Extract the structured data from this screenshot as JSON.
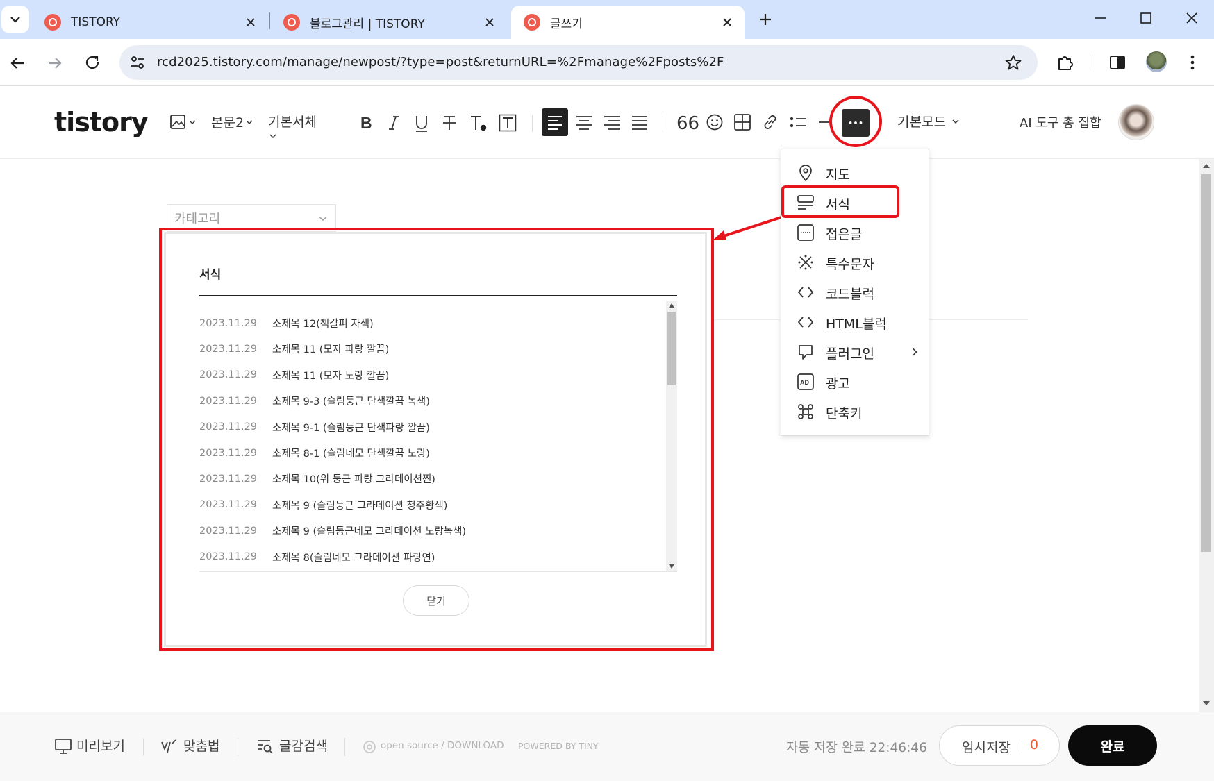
{
  "browser": {
    "tabs": [
      {
        "label": "TISTORY"
      },
      {
        "label": "블로그관리 | TISTORY"
      },
      {
        "label": "글쓰기"
      }
    ],
    "url": "rcd2025.tistory.com/manage/newpost/?type=post&returnURL=%2Fmanage%2Fposts%2F"
  },
  "editor": {
    "logo": "tistory",
    "paragraph_style": "본문2",
    "font": "기본서체",
    "mode": "기본모드",
    "ai_tools": "AI 도구 총 집합",
    "category_placeholder": "카테고리"
  },
  "more_menu": {
    "items": [
      {
        "label": "지도",
        "icon": "map-pin-icon"
      },
      {
        "label": "서식",
        "icon": "template-icon"
      },
      {
        "label": "접은글",
        "icon": "folded-text-icon"
      },
      {
        "label": "특수문자",
        "icon": "special-char-icon"
      },
      {
        "label": "코드블럭",
        "icon": "code-icon"
      },
      {
        "label": "HTML블럭",
        "icon": "html-icon"
      },
      {
        "label": "플러그인",
        "icon": "plugin-icon"
      },
      {
        "label": "광고",
        "icon": "ad-icon"
      },
      {
        "label": "단축키",
        "icon": "shortcut-icon"
      }
    ]
  },
  "template_modal": {
    "title": "서식",
    "rows": [
      {
        "date": "2023.11.29",
        "title": "소제목 12(책갈피 자색)"
      },
      {
        "date": "2023.11.29",
        "title": "소제목 11 (모자 파랑 깔끔)"
      },
      {
        "date": "2023.11.29",
        "title": "소제목 11 (모자 노랑 깔끔)"
      },
      {
        "date": "2023.11.29",
        "title": "소제목 9-3 (슬림둥근 단색깔끔 녹색)"
      },
      {
        "date": "2023.11.29",
        "title": "소제목 9-1 (슬림둥근 단색파랑 깔끔)"
      },
      {
        "date": "2023.11.29",
        "title": "소제목 8-1 (슬림네모 단색깔끔 노랑)"
      },
      {
        "date": "2023.11.29",
        "title": "소제목 10(위 둥근 파랑 그라데이션찐)"
      },
      {
        "date": "2023.11.29",
        "title": "소제목 9 (슬림둥근 그라데이션 청주황색)"
      },
      {
        "date": "2023.11.29",
        "title": "소제목 9 (슬림둥근네모 그라데이션 노랑녹색)"
      },
      {
        "date": "2023.11.29",
        "title": "소제목 8(슬림네모 그라데이션 파랑연)"
      }
    ],
    "close_label": "닫기"
  },
  "footer": {
    "preview": "미리보기",
    "spellcheck": "맞춤법",
    "material_search": "글감검색",
    "open_source": "open source / DOWNLOAD",
    "powered_by": "POWERED BY TINY",
    "autosave": "자동 저장 완료 22:46:46",
    "temp_save": "임시저장",
    "temp_save_count": "0",
    "publish": "완료"
  },
  "colors": {
    "annotation_red": "#e8141c",
    "tab_bar": "#d3e3fd",
    "favicon": "#ef5b4c",
    "count_orange": "#f25c2a"
  }
}
